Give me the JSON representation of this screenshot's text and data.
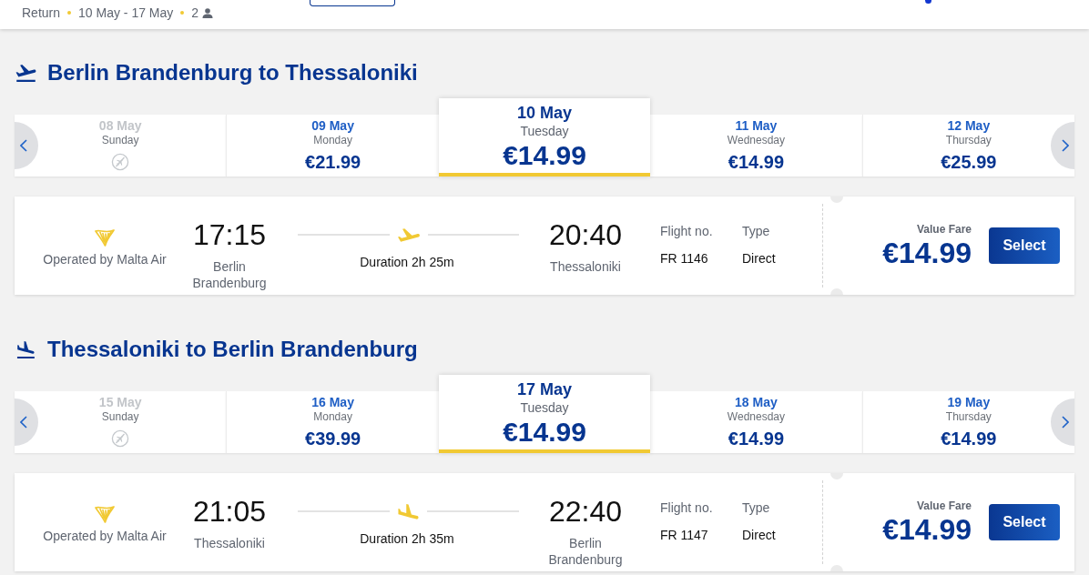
{
  "header": {
    "trip_type": "Return",
    "dates": "10 May - 17 May",
    "passengers": "2"
  },
  "routes": [
    {
      "kind": "departure",
      "title": "Berlin Brandenburg to Thessaloniki",
      "dates": [
        {
          "date": "08 May",
          "day": "Sunday",
          "available": false,
          "selected": false
        },
        {
          "date": "09 May",
          "day": "Monday",
          "price": "€21.99",
          "available": true,
          "selected": false
        },
        {
          "date": "10 May",
          "day": "Tuesday",
          "price": "€14.99",
          "available": true,
          "selected": true
        },
        {
          "date": "11 May",
          "day": "Wednesday",
          "price": "€14.99",
          "available": true,
          "selected": false
        },
        {
          "date": "12 May",
          "day": "Thursday",
          "price": "€25.99",
          "available": true,
          "selected": false
        }
      ],
      "flight": {
        "operator": "Operated by Malta Air",
        "departure_time": "17:15",
        "departure_city": "Berlin Brandenburg",
        "duration": "Duration 2h 25m",
        "arrival_time": "20:40",
        "arrival_city": "Thessaloniki",
        "flight_no_label": "Flight no.",
        "flight_no": "FR 1146",
        "type_label": "Type",
        "type": "Direct",
        "fare_label": "Value Fare",
        "price": "€14.99",
        "button": "Select"
      }
    },
    {
      "kind": "arrival",
      "title": "Thessaloniki to Berlin Brandenburg",
      "dates": [
        {
          "date": "15 May",
          "day": "Sunday",
          "available": false,
          "selected": false
        },
        {
          "date": "16 May",
          "day": "Monday",
          "price": "€39.99",
          "available": true,
          "selected": false
        },
        {
          "date": "17 May",
          "day": "Tuesday",
          "price": "€14.99",
          "available": true,
          "selected": true
        },
        {
          "date": "18 May",
          "day": "Wednesday",
          "price": "€14.99",
          "available": true,
          "selected": false
        },
        {
          "date": "19 May",
          "day": "Thursday",
          "price": "€14.99",
          "available": true,
          "selected": false
        }
      ],
      "flight": {
        "operator": "Operated by Malta Air",
        "departure_time": "21:05",
        "departure_city": "Thessaloniki",
        "duration": "Duration 2h 35m",
        "arrival_time": "22:40",
        "arrival_city": "Berlin Brandenburg",
        "flight_no_label": "Flight no.",
        "flight_no": "FR 1147",
        "type_label": "Type",
        "type": "Direct",
        "fare_label": "Value Fare",
        "price": "€14.99",
        "button": "Select"
      }
    }
  ]
}
